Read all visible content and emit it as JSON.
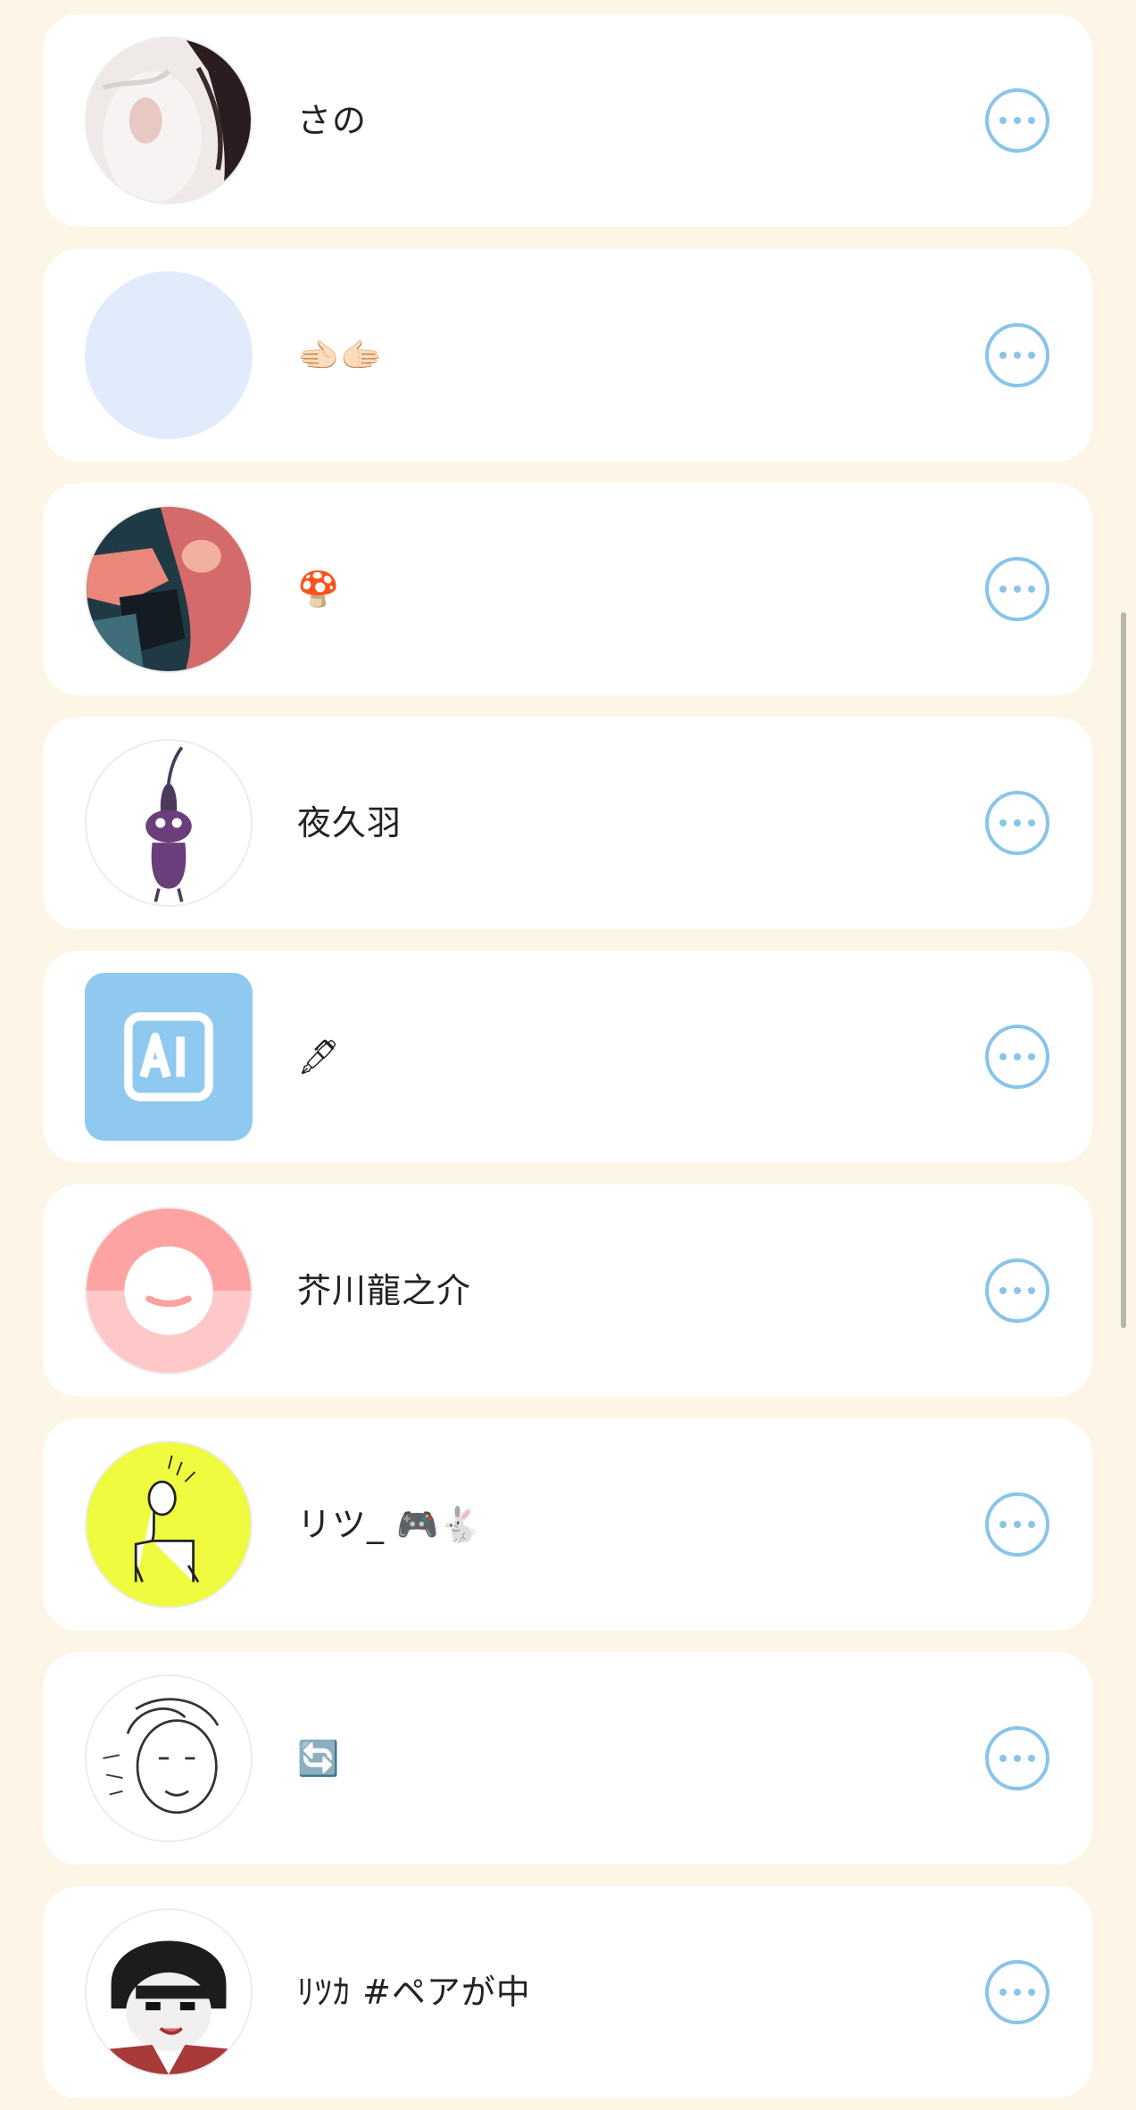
{
  "users": [
    {
      "name": "さの",
      "avatar": "photo-girl"
    },
    {
      "name": "🫲🏻🫱🏻",
      "avatar": "blank-blue"
    },
    {
      "name": "🍄",
      "avatar": "anime-red"
    },
    {
      "name": "夜久羽",
      "avatar": "pikmin"
    },
    {
      "name": "🖋",
      "avatar": "ai-badge"
    },
    {
      "name": "芥川龍之介",
      "avatar": "default-smile"
    },
    {
      "name": "リツ_ 🎮🐇",
      "avatar": "yellow-doodle"
    },
    {
      "name": "🔄",
      "avatar": "sketch-face"
    },
    {
      "name": "ﾘﾂｶ #ペアが中",
      "avatar": "anime-boy"
    }
  ],
  "colors": {
    "background": "#fdf5e6",
    "card": "#ffffff",
    "accent": "#89c4ea"
  },
  "icons": {
    "more": "more-horizontal-circle-icon"
  }
}
